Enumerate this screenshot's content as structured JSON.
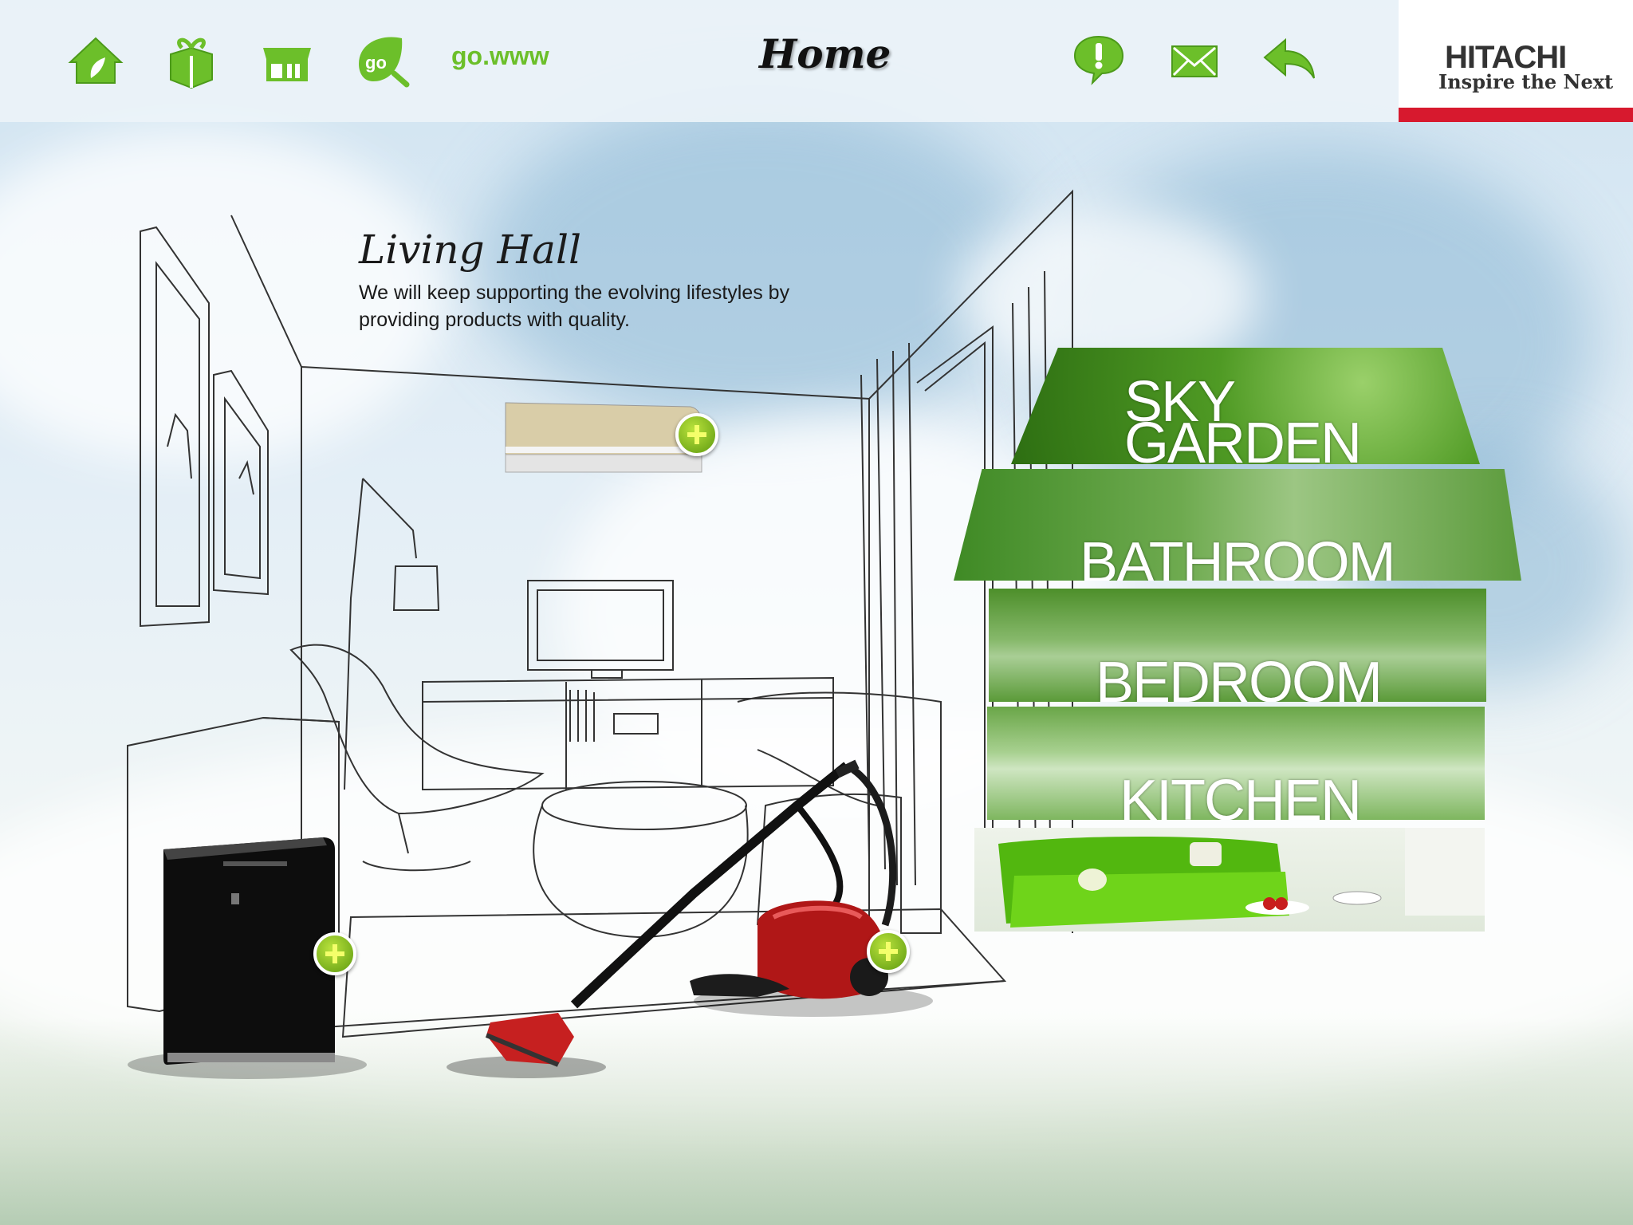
{
  "header": {
    "nav": [
      {
        "name": "home-icon"
      },
      {
        "name": "gift-box-icon"
      },
      {
        "name": "store-icon"
      },
      {
        "name": "go-search-icon",
        "label": "go"
      }
    ],
    "go_link": "go.www",
    "title": "Home",
    "actions": [
      {
        "name": "alert-icon"
      },
      {
        "name": "mail-icon"
      },
      {
        "name": "back-arrow-icon"
      }
    ]
  },
  "logo": {
    "brand": "HITACHI",
    "tagline": "Inspire the Next"
  },
  "room": {
    "title": "Living Hall",
    "description": "We will keep supporting the evolving lifestyles by providing products with quality."
  },
  "house_menu": {
    "sky_garden": [
      "SKY",
      "GARDEN"
    ],
    "bathroom": "BATHROOM",
    "bedroom": "BEDROOM",
    "kitchen": "KITCHEN"
  },
  "colors": {
    "accent": "#6cbf2a",
    "brand_red": "#d7192e",
    "menu_green": "#4e9a2a"
  }
}
